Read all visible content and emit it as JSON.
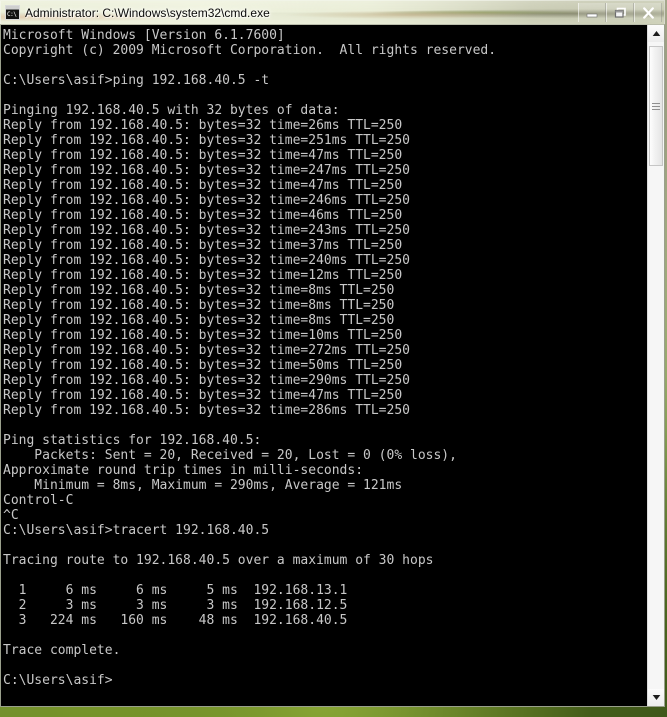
{
  "window": {
    "title": "Administrator: C:\\Windows\\system32\\cmd.exe",
    "icon_name": "cmd-console-icon",
    "icon_text": "C:\\",
    "controls": {
      "minimize_label": "Minimize",
      "restore_label": "Restore",
      "close_label": "Close"
    }
  },
  "console": {
    "background_color": "#000000",
    "text_color": "#c8c8c8",
    "prompt": "C:\\Users\\asif>",
    "lines": [
      "Microsoft Windows [Version 6.1.7600]",
      "Copyright (c) 2009 Microsoft Corporation.  All rights reserved.",
      "",
      "C:\\Users\\asif>ping 192.168.40.5 -t",
      "",
      "Pinging 192.168.40.5 with 32 bytes of data:",
      "Reply from 192.168.40.5: bytes=32 time=26ms TTL=250",
      "Reply from 192.168.40.5: bytes=32 time=251ms TTL=250",
      "Reply from 192.168.40.5: bytes=32 time=47ms TTL=250",
      "Reply from 192.168.40.5: bytes=32 time=247ms TTL=250",
      "Reply from 192.168.40.5: bytes=32 time=47ms TTL=250",
      "Reply from 192.168.40.5: bytes=32 time=246ms TTL=250",
      "Reply from 192.168.40.5: bytes=32 time=46ms TTL=250",
      "Reply from 192.168.40.5: bytes=32 time=243ms TTL=250",
      "Reply from 192.168.40.5: bytes=32 time=37ms TTL=250",
      "Reply from 192.168.40.5: bytes=32 time=240ms TTL=250",
      "Reply from 192.168.40.5: bytes=32 time=12ms TTL=250",
      "Reply from 192.168.40.5: bytes=32 time=8ms TTL=250",
      "Reply from 192.168.40.5: bytes=32 time=8ms TTL=250",
      "Reply from 192.168.40.5: bytes=32 time=8ms TTL=250",
      "Reply from 192.168.40.5: bytes=32 time=10ms TTL=250",
      "Reply from 192.168.40.5: bytes=32 time=272ms TTL=250",
      "Reply from 192.168.40.5: bytes=32 time=50ms TTL=250",
      "Reply from 192.168.40.5: bytes=32 time=290ms TTL=250",
      "Reply from 192.168.40.5: bytes=32 time=47ms TTL=250",
      "Reply from 192.168.40.5: bytes=32 time=286ms TTL=250",
      "",
      "Ping statistics for 192.168.40.5:",
      "    Packets: Sent = 20, Received = 20, Lost = 0 (0% loss),",
      "Approximate round trip times in milli-seconds:",
      "    Minimum = 8ms, Maximum = 290ms, Average = 121ms",
      "Control-C",
      "^C",
      "C:\\Users\\asif>tracert 192.168.40.5",
      "",
      "Tracing route to 192.168.40.5 over a maximum of 30 hops",
      "",
      "  1     6 ms     6 ms     5 ms  192.168.13.1",
      "  2     3 ms     3 ms     3 ms  192.168.12.5",
      "  3   224 ms   160 ms    48 ms  192.168.40.5",
      "",
      "Trace complete.",
      "",
      "C:\\Users\\asif>"
    ]
  },
  "ping_session": {
    "command": "ping 192.168.40.5 -t",
    "target": "192.168.40.5",
    "bytes": 32,
    "times_ms": [
      26,
      251,
      47,
      247,
      47,
      246,
      46,
      243,
      37,
      240,
      12,
      8,
      8,
      8,
      10,
      272,
      50,
      290,
      47,
      286
    ],
    "ttl": 250,
    "sent": 20,
    "received": 20,
    "lost": 0,
    "loss_percent": "0%",
    "minimum_ms": 8,
    "maximum_ms": 290,
    "average_ms": 121,
    "interrupt": "Control-C"
  },
  "tracert_session": {
    "command": "tracert 192.168.40.5",
    "target": "192.168.40.5",
    "max_hops": 30,
    "hops": [
      {
        "hop": 1,
        "rtt1": "6 ms",
        "rtt2": "6 ms",
        "rtt3": "5 ms",
        "host": "192.168.13.1"
      },
      {
        "hop": 2,
        "rtt1": "3 ms",
        "rtt2": "3 ms",
        "rtt3": "3 ms",
        "host": "192.168.12.5"
      },
      {
        "hop": 3,
        "rtt1": "224 ms",
        "rtt2": "160 ms",
        "rtt3": "48 ms",
        "host": "192.168.40.5"
      }
    ],
    "status": "Trace complete."
  },
  "scrollbar": {
    "up_arrow_name": "scroll-up-arrow",
    "down_arrow_name": "scroll-down-arrow",
    "thumb_name": "scrollbar-thumb"
  }
}
